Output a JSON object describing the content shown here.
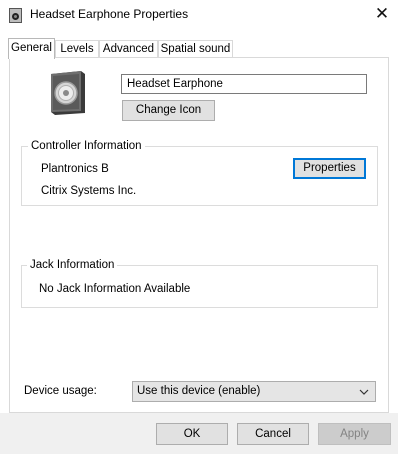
{
  "window": {
    "title": "Headset Earphone Properties",
    "close_glyph": "✕",
    "icon": "speaker-app-icon"
  },
  "tabs": [
    {
      "label": "General",
      "active": true
    },
    {
      "label": "Levels",
      "active": false
    },
    {
      "label": "Advanced",
      "active": false
    },
    {
      "label": "Spatial sound",
      "active": false
    }
  ],
  "general": {
    "device_icon": "headset-speaker-icon",
    "device_name": "Headset Earphone",
    "change_icon_label": "Change Icon"
  },
  "controller": {
    "heading": "Controller Information",
    "name": "Plantronics B",
    "vendor": "Citrix Systems Inc.",
    "properties_label": "Properties"
  },
  "jack": {
    "heading": "Jack Information",
    "text": "No Jack Information Available"
  },
  "device_usage": {
    "label": "Device usage:",
    "selected": "Use this device (enable)",
    "icon": "chevron-down-icon"
  },
  "footer": {
    "ok_label": "OK",
    "cancel_label": "Cancel",
    "apply_label": "Apply"
  },
  "colors": {
    "focus_border": "#0078d7",
    "button_face": "#e1e1e1",
    "disabled_text": "#838383",
    "footer_bg": "#f0f0f0"
  }
}
